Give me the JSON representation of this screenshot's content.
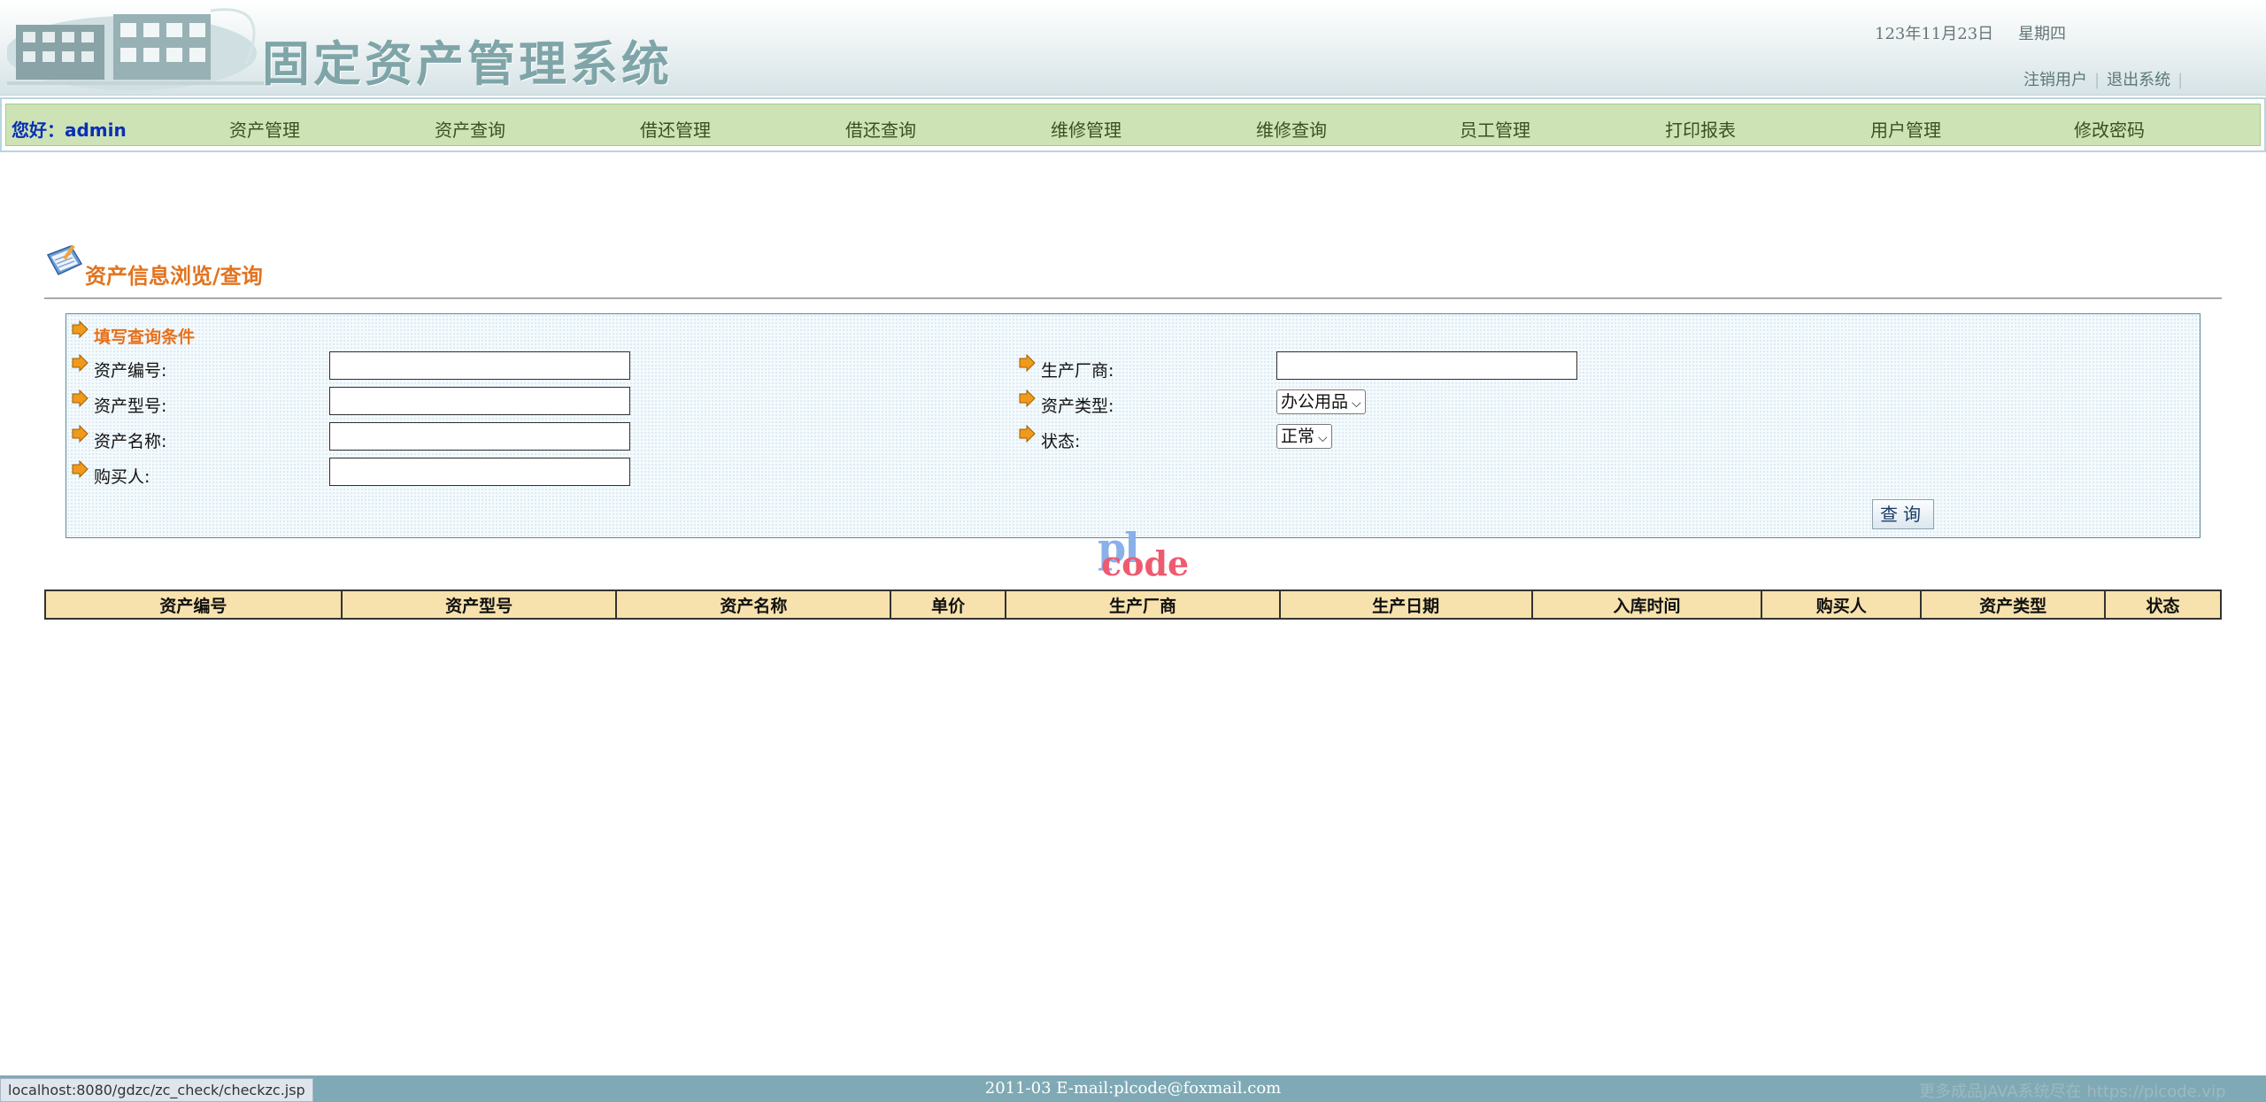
{
  "header": {
    "title": "固定资产管理系统",
    "date": "123年11月23日",
    "weekday": "星期四",
    "links": [
      "注销用户",
      "退出系统"
    ]
  },
  "nav": {
    "greeting": "您好：admin",
    "items": [
      "资产管理",
      "资产查询",
      "借还管理",
      "借还查询",
      "维修管理",
      "维修查询",
      "员工管理",
      "打印报表",
      "用户管理",
      "修改密码"
    ]
  },
  "page": {
    "title": "资产信息浏览/查询"
  },
  "form": {
    "heading": "填写查询条件",
    "fields": {
      "asset_no": {
        "label": "资产编号:",
        "value": ""
      },
      "asset_model": {
        "label": "资产型号:",
        "value": ""
      },
      "asset_name": {
        "label": "资产名称:",
        "value": ""
      },
      "buyer": {
        "label": "购买人:",
        "value": ""
      },
      "manufacturer": {
        "label": "生产厂商:",
        "value": ""
      },
      "asset_type": {
        "label": "资产类型:",
        "value": "办公用品"
      },
      "status": {
        "label": "状态:",
        "value": "正常"
      }
    },
    "query_button": "查询"
  },
  "watermark": {
    "top": "pl",
    "bottom": "code"
  },
  "table": {
    "columns": [
      "资产编号",
      "资产型号",
      "资产名称",
      "单价",
      "生产厂商",
      "生产日期",
      "入库时间",
      "购买人",
      "资产类型",
      "状态"
    ]
  },
  "footer": {
    "copyright": "2011-03 E-mail:plcode@foxmail.com",
    "watermark_text": "更多成品JAVA系统尽在 https://plcode.vip"
  },
  "status_bar": {
    "url": "localhost:8080/gdzc/zc_check/checkzc.jsp"
  },
  "colors": {
    "nav_bg": "#cde3b5",
    "greeting": "#0a2fb5",
    "accent_orange": "#e2731f",
    "table_header_bg": "#f7e2ad",
    "footer_bg": "#7faab5"
  },
  "icons": [
    "building-logo-icon",
    "notebook-icon",
    "orange-arrow-icon"
  ]
}
